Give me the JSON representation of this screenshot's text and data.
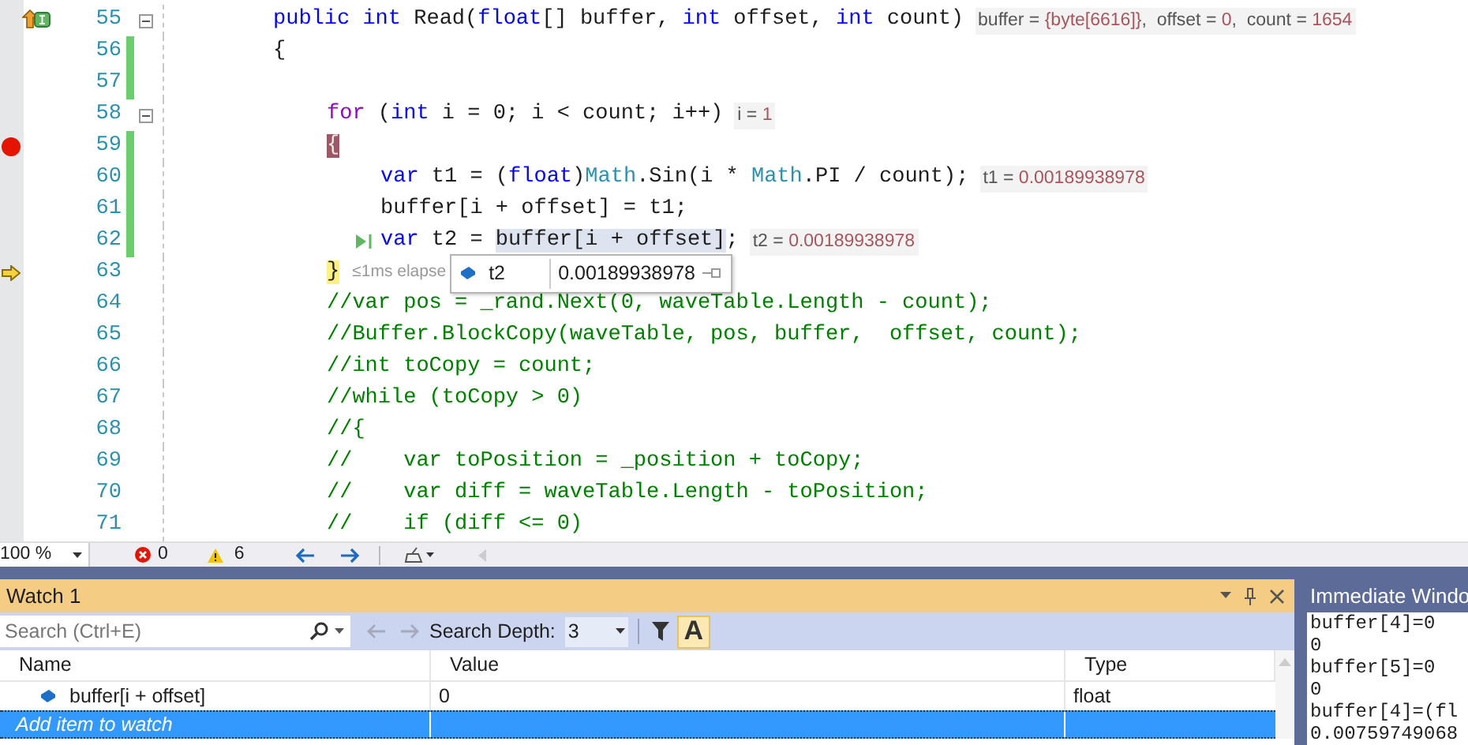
{
  "editor": {
    "lines": [
      {
        "number": "55",
        "kind": "top",
        "trace_marker": true,
        "foldable": true,
        "tokens": [
          {
            "text": "public int",
            "kind": "keyword"
          },
          {
            "text": " Read(",
            "kind": "plain"
          },
          {
            "text": "float",
            "kind": "keyword"
          },
          {
            "text": "[] buffer, ",
            "kind": "plain"
          },
          {
            "text": "int",
            "kind": "keyword"
          },
          {
            "text": " offset, ",
            "kind": "plain"
          },
          {
            "text": "int",
            "kind": "keyword"
          },
          {
            "text": " count)",
            "kind": "plain"
          }
        ],
        "hint": [
          {
            "text": "buffer = ",
            "kind": "name"
          },
          {
            "text": "{byte[6616]}",
            "kind": "value"
          },
          {
            "text": ",  offset = ",
            "kind": "name"
          },
          {
            "text": "0",
            "kind": "value"
          },
          {
            "text": ",  count = ",
            "kind": "name"
          },
          {
            "text": "1654",
            "kind": "value"
          }
        ]
      },
      {
        "number": "56",
        "kind": "top",
        "changed": true,
        "tokens": [
          {
            "text": "{",
            "kind": "plain"
          }
        ]
      },
      {
        "number": "57",
        "kind": "top",
        "changed": true
      },
      {
        "number": "58",
        "kind": "block",
        "foldable": true,
        "tokens": [
          {
            "text": "for",
            "kind": "control"
          },
          {
            "text": " (",
            "kind": "plain"
          },
          {
            "text": "int",
            "kind": "keyword"
          },
          {
            "text": " i = 0; i < count; i++)",
            "kind": "plain"
          }
        ],
        "hint": [
          {
            "text": "i = ",
            "kind": "name"
          },
          {
            "text": "1",
            "kind": "value"
          }
        ]
      },
      {
        "number": "59",
        "kind": "block",
        "breakpoint": true,
        "changed": true,
        "tokens": [
          {
            "text": "{",
            "kind": "breakpoint"
          }
        ]
      },
      {
        "number": "60",
        "kind": "body",
        "changed": true,
        "tokens": [
          {
            "text": "var",
            "kind": "keyword"
          },
          {
            "text": " t1 = (",
            "kind": "plain"
          },
          {
            "text": "float",
            "kind": "keyword"
          },
          {
            "text": ")",
            "kind": "plain"
          },
          {
            "text": "Math",
            "kind": "type"
          },
          {
            "text": ".Sin(i * ",
            "kind": "plain"
          },
          {
            "text": "Math",
            "kind": "type"
          },
          {
            "text": ".PI / count);",
            "kind": "plain"
          }
        ],
        "hint": [
          {
            "text": "t1 = ",
            "kind": "name"
          },
          {
            "text": "0.00189938978",
            "kind": "value"
          }
        ]
      },
      {
        "number": "61",
        "kind": "body",
        "changed": true,
        "tokens": [
          {
            "text": "buffer[i + offset] = t1;",
            "kind": "plain"
          }
        ]
      },
      {
        "number": "62",
        "kind": "body",
        "changed": true,
        "run_to_click": true,
        "tokens": [
          {
            "text": "var",
            "kind": "keyword"
          },
          {
            "text": " t2 = ",
            "kind": "plain"
          },
          {
            "text": "buffer[i + offset]",
            "kind": "selection"
          },
          {
            "text": ";",
            "kind": "plain"
          }
        ],
        "hint": [
          {
            "text": "t2 = ",
            "kind": "name"
          },
          {
            "text": "0.00189938978",
            "kind": "value"
          }
        ]
      },
      {
        "number": "63",
        "kind": "block",
        "current": true,
        "tokens": [
          {
            "text": "}",
            "kind": "current"
          }
        ],
        "elapsed": "≤1ms elapse",
        "datatip": {
          "name": "t2",
          "value": "0.00189938978"
        }
      },
      {
        "number": "64",
        "kind": "block",
        "tokens": [
          {
            "text": "//var pos = _rand.Next(0, waveTable.Length - count);",
            "kind": "comment"
          }
        ]
      },
      {
        "number": "65",
        "kind": "block",
        "tokens": [
          {
            "text": "//Buffer.BlockCopy(waveTable, pos, buffer,  offset, count);",
            "kind": "comment"
          }
        ]
      },
      {
        "number": "66",
        "kind": "block",
        "tokens": [
          {
            "text": "//int toCopy = count;",
            "kind": "comment"
          }
        ]
      },
      {
        "number": "67",
        "kind": "block",
        "tokens": [
          {
            "text": "//while (toCopy > 0)",
            "kind": "comment"
          }
        ]
      },
      {
        "number": "68",
        "kind": "block",
        "tokens": [
          {
            "text": "//{",
            "kind": "comment"
          }
        ]
      },
      {
        "number": "69",
        "kind": "block",
        "tokens": [
          {
            "text": "//    var toPosition = _position + toCopy;",
            "kind": "comment"
          }
        ]
      },
      {
        "number": "70",
        "kind": "block",
        "tokens": [
          {
            "text": "//    var diff = waveTable.Length - toPosition;",
            "kind": "comment"
          }
        ]
      },
      {
        "number": "71",
        "kind": "block",
        "tokens": [
          {
            "text": "//    if (diff <= 0)",
            "kind": "comment"
          }
        ]
      }
    ]
  },
  "editor_toolbar": {
    "zoom": "100 %",
    "errors": "0",
    "warnings": "6"
  },
  "watch": {
    "title": "Watch 1",
    "search": {
      "placeholder": "Search (Ctrl+E)"
    },
    "depth_label": "Search Depth:",
    "depth": "3",
    "match_case": {
      "label": "A",
      "selected": true
    },
    "columns": [
      "Name",
      "Value",
      "Type"
    ],
    "rows": [
      {
        "name": "buffer[i + offset]",
        "value": "0",
        "type": "float",
        "selected": false
      }
    ],
    "add_row": {
      "placeholder": "Add item to watch",
      "selected": true
    }
  },
  "immediate": {
    "title": "Immediate Windo",
    "lines": [
      "buffer[4]=0",
      "0",
      "buffer[5]=0",
      "0",
      "buffer[4]=(fl",
      "0.00759749068"
    ]
  }
}
